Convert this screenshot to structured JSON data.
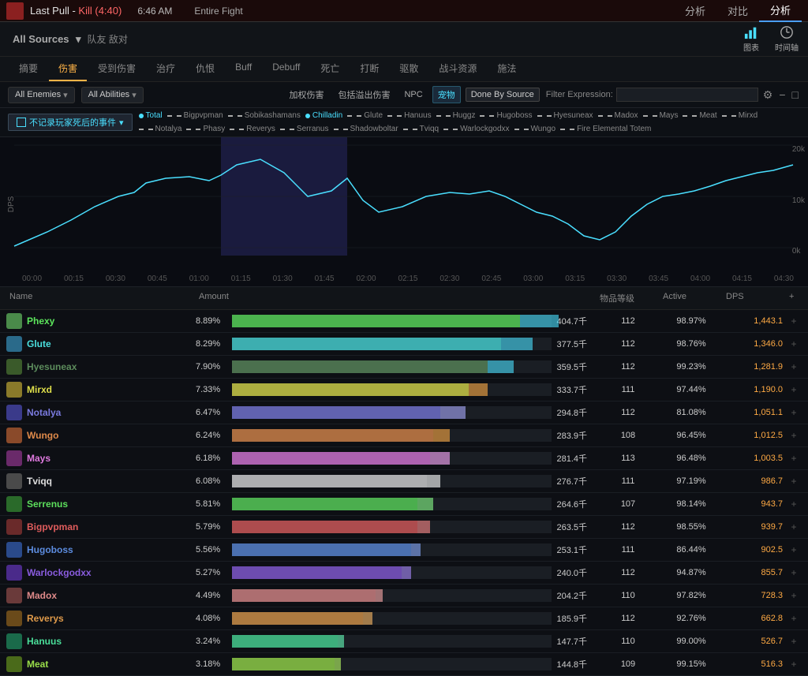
{
  "topbar": {
    "pull_icon_bg": "#8b2020",
    "title": "Last Pull - ",
    "kill_text": "Kill (4:40)",
    "time": "6:46 AM",
    "fight": "Entire Fight",
    "nav_items": [
      "分析",
      "对比",
      "分析"
    ],
    "active_nav": 0
  },
  "header": {
    "source_label": "All Sources",
    "dropdown_arrow": "▾",
    "team_label": "队友 敌对",
    "icon_chart": "图表",
    "icon_timeline": "时间轴"
  },
  "tabs": [
    {
      "label": "摘要",
      "active": false
    },
    {
      "label": "伤害",
      "active": true
    },
    {
      "label": "受到伤害",
      "active": false
    },
    {
      "label": "治疗",
      "active": false
    },
    {
      "label": "仇恨",
      "active": false
    },
    {
      "label": "Buff",
      "active": false
    },
    {
      "label": "Debuff",
      "active": false
    },
    {
      "label": "死亡",
      "active": false
    },
    {
      "label": "打断",
      "active": false
    },
    {
      "label": "驱散",
      "active": false
    },
    {
      "label": "战斗资源",
      "active": false
    },
    {
      "label": "施法",
      "active": false
    }
  ],
  "filters": {
    "enemies_btn": "All Enemies",
    "abilities_btn": "All Abilities",
    "rights": {
      "tag1": "加权伤害",
      "tag2": "包括溢出伤害",
      "tag3": "NPC",
      "tag4": "宠物",
      "tag5": "Done By Source",
      "filter_label": "Filter Expression:"
    }
  },
  "event_selector": {
    "label": "不记录玩家死后的事件",
    "arrow": "▾"
  },
  "legend": [
    {
      "name": "Total",
      "color": "#4adfff",
      "dashed": false
    },
    {
      "name": "Bigpvpman",
      "color": "#aaaaaa",
      "dashed": true
    },
    {
      "name": "Sobikashamans",
      "color": "#aaaaaa",
      "dashed": true
    },
    {
      "name": "Chilladin",
      "color": "#4adfff",
      "dashed": false
    },
    {
      "name": "Glute",
      "color": "#aaaaaa",
      "dashed": true
    },
    {
      "name": "Hanuus",
      "color": "#aaaaaa",
      "dashed": true
    },
    {
      "name": "Huggz",
      "color": "#aaaaaa",
      "dashed": true
    },
    {
      "name": "Hugoboss",
      "color": "#aaaaaa",
      "dashed": true
    },
    {
      "name": "Hyesuneax",
      "color": "#aaaaaa",
      "dashed": true
    },
    {
      "name": "Madox",
      "color": "#aaaaaa",
      "dashed": true
    },
    {
      "name": "Mays",
      "color": "#aaaaaa",
      "dashed": true
    },
    {
      "name": "Meat",
      "color": "#aaaaaa",
      "dashed": true
    },
    {
      "name": "Mirxd",
      "color": "#aaaaaa",
      "dashed": true
    },
    {
      "name": "Notalya",
      "color": "#aaaaaa",
      "dashed": true
    },
    {
      "name": "Phasy",
      "color": "#aaaaaa",
      "dashed": true
    },
    {
      "name": "Reverys",
      "color": "#aaaaaa",
      "dashed": true
    },
    {
      "name": "Serranus",
      "color": "#aaaaaa",
      "dashed": true
    },
    {
      "name": "Shadowboltar",
      "color": "#aaaaaa",
      "dashed": true
    },
    {
      "name": "Tviqq",
      "color": "#aaaaaa",
      "dashed": true
    },
    {
      "name": "Warlockgodxx",
      "color": "#aaaaaa",
      "dashed": true
    },
    {
      "name": "Wungo",
      "color": "#aaaaaa",
      "dashed": true
    },
    {
      "name": "Fire Elemental Totem",
      "color": "#aaaaaa",
      "dashed": true
    }
  ],
  "chart": {
    "y_label": "DPS",
    "y_max": "20k",
    "y_mid": "10k",
    "y_min": "0k",
    "time_labels": [
      "00:00",
      "00:15",
      "00:30",
      "00:45",
      "01:00",
      "01:15",
      "01:30",
      "01:45",
      "02:00",
      "02:15",
      "02:30",
      "02:45",
      "03:00",
      "03:15",
      "03:30",
      "03:45",
      "04:00",
      "04:15",
      "04:30"
    ]
  },
  "table": {
    "headers": [
      "Name",
      "Amount",
      "物品等级",
      "Active",
      "DPS",
      "+"
    ],
    "rows": [
      {
        "name": "Phexy",
        "pct": "8.89%",
        "amount": "404.7千",
        "quality": "112",
        "active": "98.97%",
        "dps": "1,443.1",
        "bar_pct": 90,
        "bar2_pct": 12,
        "bar_color": "#5ce65c",
        "bar2_color": "#4adfff",
        "icon_color": "#4a8a4a"
      },
      {
        "name": "Glute",
        "pct": "8.29%",
        "amount": "377.5千",
        "quality": "112",
        "active": "98.76%",
        "dps": "1,346.0",
        "bar_pct": 84,
        "bar2_pct": 10,
        "bar_color": "#4adfdf",
        "bar2_color": "#4adfff",
        "icon_color": "#2a6a8a"
      },
      {
        "name": "Hyesuneax",
        "pct": "7.90%",
        "amount": "359.5千",
        "quality": "112",
        "active": "99.23%",
        "dps": "1,281.9",
        "bar_pct": 80,
        "bar2_pct": 8,
        "bar_color": "#5c8c5c",
        "bar2_color": "#4adfff",
        "icon_color": "#3a5a2a"
      },
      {
        "name": "Mirxd",
        "pct": "7.33%",
        "amount": "333.7千",
        "quality": "111",
        "active": "97.44%",
        "dps": "1,190.0",
        "bar_pct": 74,
        "bar2_pct": 6,
        "bar_color": "#dfdf4a",
        "bar2_color": "#ffaa44",
        "icon_color": "#8a7a2a"
      },
      {
        "name": "Notalya",
        "pct": "6.47%",
        "amount": "294.8千",
        "quality": "112",
        "active": "81.08%",
        "dps": "1,051.1",
        "bar_pct": 65,
        "bar2_pct": 8,
        "bar_color": "#7a7adf",
        "bar2_color": "#aaaaff",
        "icon_color": "#3a3a8a"
      },
      {
        "name": "Wungo",
        "pct": "6.24%",
        "amount": "283.9千",
        "quality": "108",
        "active": "96.45%",
        "dps": "1,012.5",
        "bar_pct": 63,
        "bar2_pct": 5,
        "bar_color": "#df8a4a",
        "bar2_color": "#ffaa44",
        "icon_color": "#8a4a2a"
      },
      {
        "name": "Mays",
        "pct": "6.18%",
        "amount": "281.4千",
        "quality": "113",
        "active": "96.48%",
        "dps": "1,003.5",
        "bar_pct": 62,
        "bar2_pct": 6,
        "bar_color": "#df7adf",
        "bar2_color": "#ffaaff",
        "icon_color": "#6a2a6a"
      },
      {
        "name": "Tviqq",
        "pct": "6.08%",
        "amount": "276.7千",
        "quality": "111",
        "active": "97.19%",
        "dps": "986.7",
        "bar_pct": 61,
        "bar2_pct": 4,
        "bar_color": "#dfdfdf",
        "bar2_color": "#ffffff",
        "icon_color": "#4a4a4a"
      },
      {
        "name": "Serrenus",
        "pct": "5.81%",
        "amount": "264.6千",
        "quality": "107",
        "active": "98.14%",
        "dps": "943.7",
        "bar_pct": 58,
        "bar2_pct": 5,
        "bar_color": "#5cdf5c",
        "bar2_color": "#88ff88",
        "icon_color": "#2a6a2a"
      },
      {
        "name": "Bigpvpman",
        "pct": "5.79%",
        "amount": "263.5千",
        "quality": "112",
        "active": "98.55%",
        "dps": "939.7",
        "bar_pct": 58,
        "bar2_pct": 4,
        "bar_color": "#df5c5c",
        "bar2_color": "#ff8888",
        "icon_color": "#6a2a2a"
      },
      {
        "name": "Hugoboss",
        "pct": "5.56%",
        "amount": "253.1千",
        "quality": "111",
        "active": "86.44%",
        "dps": "902.5",
        "bar_pct": 56,
        "bar2_pct": 3,
        "bar_color": "#5c8cdf",
        "bar2_color": "#88aaff",
        "icon_color": "#2a4a8a"
      },
      {
        "name": "Warlockgodxx",
        "pct": "5.27%",
        "amount": "240.0千",
        "quality": "112",
        "active": "94.87%",
        "dps": "855.7",
        "bar_pct": 53,
        "bar2_pct": 3,
        "bar_color": "#8a5cdf",
        "bar2_color": "#aa88ff",
        "icon_color": "#4a2a8a"
      },
      {
        "name": "Madox",
        "pct": "4.49%",
        "amount": "204.2千",
        "quality": "110",
        "active": "97.82%",
        "dps": "728.3",
        "bar_pct": 45,
        "bar2_pct": 2,
        "bar_color": "#df8a8a",
        "bar2_color": "#ffaaaa",
        "icon_color": "#6a3a3a"
      },
      {
        "name": "Reverys",
        "pct": "4.08%",
        "amount": "185.9千",
        "quality": "112",
        "active": "92.76%",
        "dps": "662.8",
        "bar_pct": 41,
        "bar2_pct": 3,
        "bar_color": "#df9a4a",
        "bar2_color": "#ffbb66",
        "icon_color": "#6a4a1a"
      },
      {
        "name": "Hanuus",
        "pct": "3.24%",
        "amount": "147.7千",
        "quality": "110",
        "active": "99.00%",
        "dps": "526.7",
        "bar_pct": 33,
        "bar2_pct": 2,
        "bar_color": "#4adf9a",
        "bar2_color": "#66ffbb",
        "icon_color": "#1a6a4a"
      },
      {
        "name": "Meat",
        "pct": "3.18%",
        "amount": "144.8千",
        "quality": "109",
        "active": "99.15%",
        "dps": "516.3",
        "bar_pct": 32,
        "bar2_pct": 2,
        "bar_color": "#9adf4a",
        "bar2_color": "#bbff66",
        "icon_color": "#4a6a1a"
      }
    ]
  }
}
